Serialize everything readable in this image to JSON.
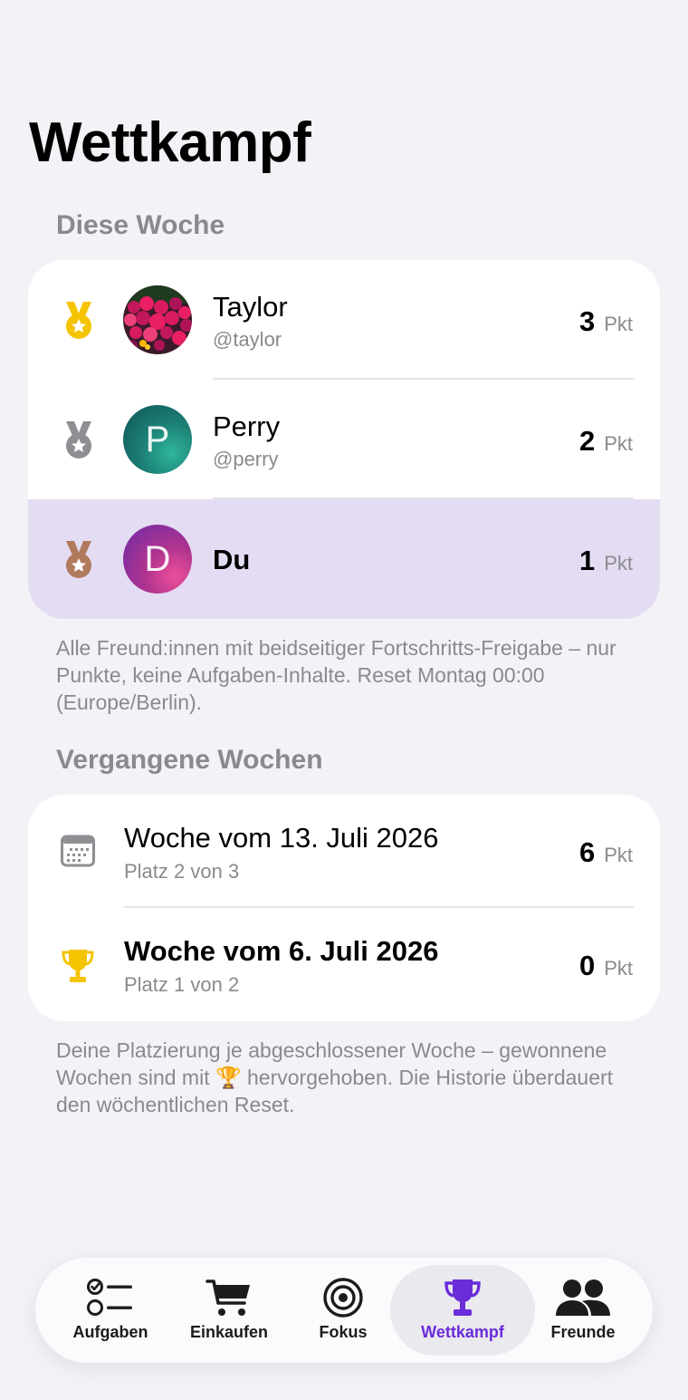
{
  "page": {
    "title": "Wettkampf"
  },
  "this_week": {
    "header": "Diese Woche",
    "rows": [
      {
        "rank_medal": "gold-medal-icon",
        "name": "Taylor",
        "handle": "@taylor",
        "points": "3",
        "unit": "Pkt"
      },
      {
        "rank_medal": "silver-medal-icon",
        "name": "Perry",
        "handle": "@perry",
        "avatar_letter": "P",
        "points": "2",
        "unit": "Pkt"
      },
      {
        "rank_medal": "bronze-medal-icon",
        "name": "Du",
        "avatar_letter": "D",
        "points": "1",
        "unit": "Pkt",
        "highlighted": true
      }
    ],
    "footnote": "Alle Freund:innen mit beidseitiger Fortschritts-Freigabe – nur Punkte, keine Aufgaben-Inhalte. Reset Montag 00:00 (Europe/Berlin)."
  },
  "past_weeks": {
    "header": "Vergangene Wochen",
    "rows": [
      {
        "icon": "calendar-icon",
        "title": "Woche vom 13. Juli 2026",
        "subtitle": "Platz 2 von 3",
        "points": "6",
        "unit": "Pkt"
      },
      {
        "icon": "trophy-icon",
        "title": "Woche vom 6. Juli 2026",
        "subtitle": "Platz 1 von 2",
        "points": "0",
        "unit": "Pkt",
        "won": true
      }
    ],
    "footnote_before": "Deine Platzierung je abgeschlossener Woche – gewonnene Wochen sind mit",
    "footnote_emoji": "🏆",
    "footnote_after": "hervorgehoben. Die Historie überdauert den wöchentlichen Reset."
  },
  "tab_bar": {
    "tabs": [
      {
        "label": "Aufgaben",
        "icon": "checklist-icon"
      },
      {
        "label": "Einkaufen",
        "icon": "cart-icon"
      },
      {
        "label": "Fokus",
        "icon": "target-icon"
      },
      {
        "label": "Wettkampf",
        "icon": "trophy-icon",
        "active": true
      },
      {
        "label": "Freunde",
        "icon": "people-icon"
      }
    ]
  },
  "colors": {
    "accent": "#6a2bd9",
    "highlight_row": "#e4dcf2",
    "gold": "#f5c400",
    "silver": "#8e8e93",
    "bronze": "#b07a5c"
  }
}
